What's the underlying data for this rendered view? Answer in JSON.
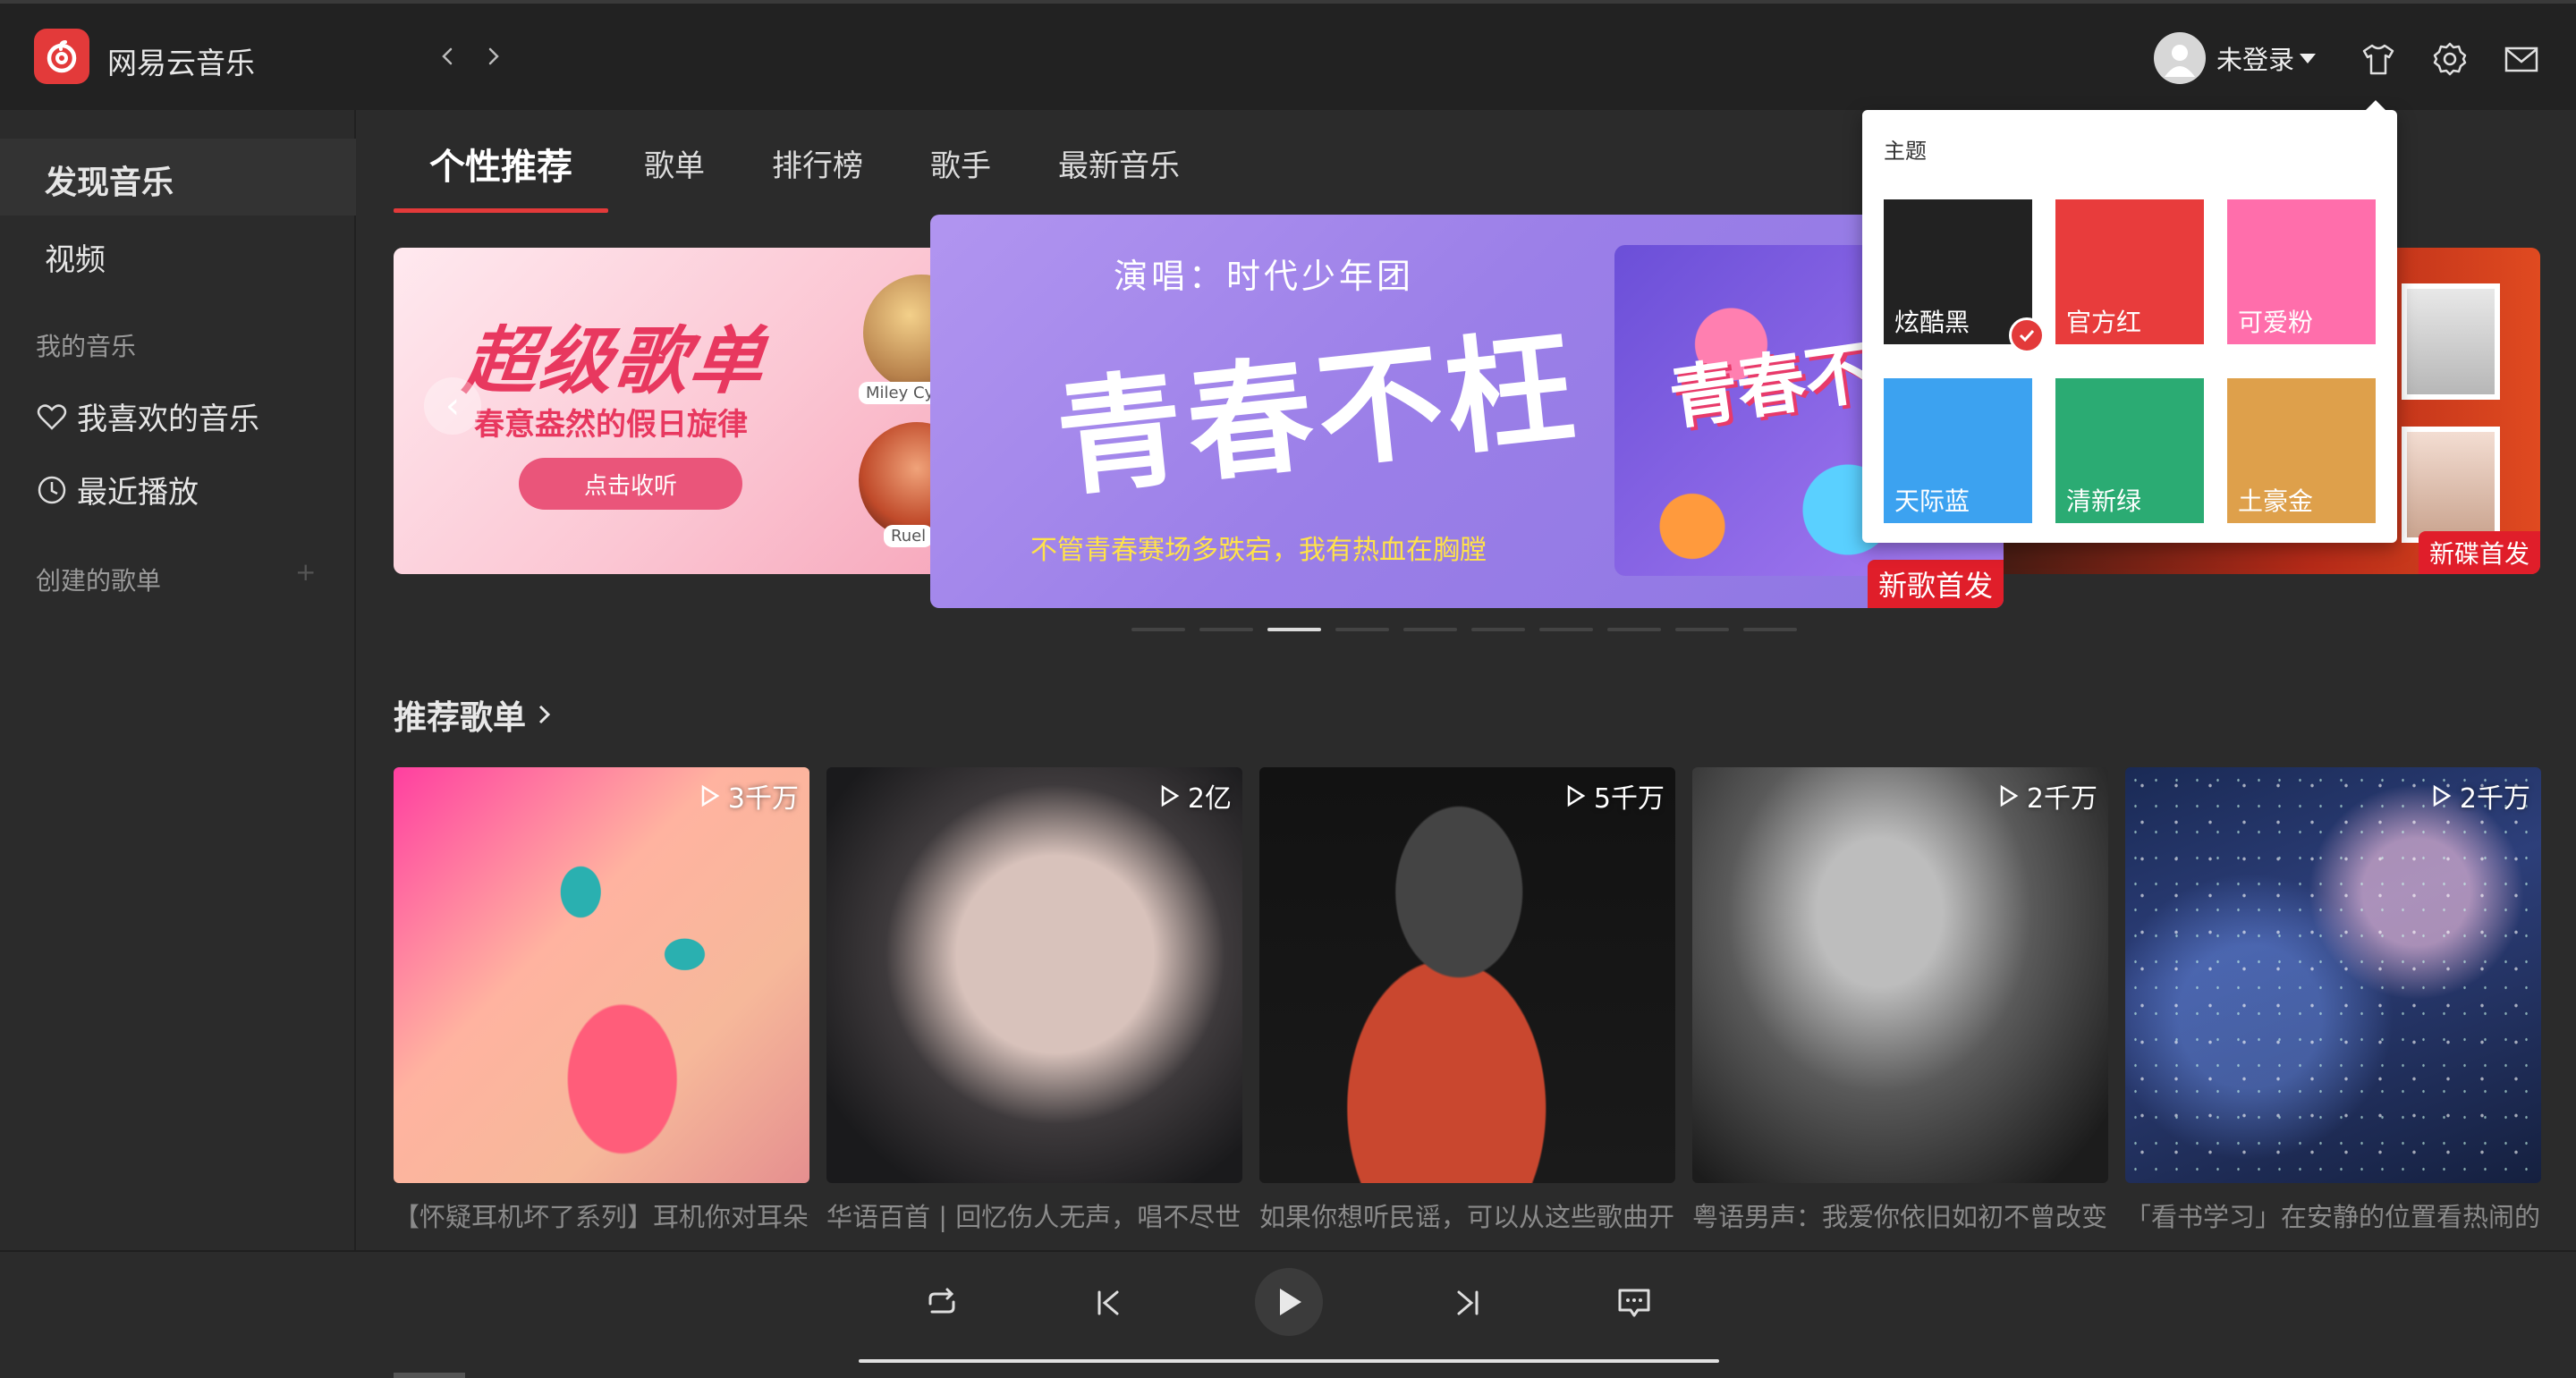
{
  "app": {
    "title": "网易云音乐"
  },
  "header": {
    "user_name": "未登录"
  },
  "sidebar": {
    "discover": "发现音乐",
    "video": "视频",
    "my_music_heading": "我的音乐",
    "liked_music": "我喜欢的音乐",
    "recent_play": "最近播放",
    "created_playlists_heading": "创建的歌单",
    "add_symbol": "+"
  },
  "tabs": [
    "个性推荐",
    "歌单",
    "排行榜",
    "歌手",
    "最新音乐"
  ],
  "banners": {
    "left": {
      "title": "超级歌单",
      "subtitle": "春意盎然的假日旋律",
      "button": "点击收听",
      "tag1": "Miley Cy",
      "tag2": "Ruel"
    },
    "main": {
      "singer": "演唱：时代少年团",
      "title": "青春不枉",
      "slogan": "不管青春赛场多跌宕，我有热血在胸膛",
      "art_title": "青春不枉",
      "badge": "新歌首发"
    },
    "right": {
      "badge": "新碟首发"
    },
    "dot_count": 10,
    "active_dot": 2
  },
  "section": {
    "recommended_title": "推荐歌单"
  },
  "playlists": [
    {
      "plays": "3千万",
      "title": "【怀疑耳机坏了系列】耳机你对耳朵做了什么"
    },
    {
      "plays": "2亿",
      "title": "华语百首 | 回忆伤人无声，唱不尽世间遗憾"
    },
    {
      "plays": "5千万",
      "title": "如果你想听民谣，可以从这些歌曲开始"
    },
    {
      "plays": "2千万",
      "title": "粤语男声：我爱你依旧如初不曾改变"
    },
    {
      "plays": "2千万",
      "title": "「看书学习」在安静的位置看热闹的世界"
    }
  ],
  "theme_popup": {
    "title": "主题",
    "swatches": [
      {
        "name": "炫酷黑",
        "color": "#222222",
        "selected": true
      },
      {
        "name": "官方红",
        "color": "#e83c3c",
        "selected": false
      },
      {
        "name": "可爱粉",
        "color": "#ff6eab",
        "selected": false
      },
      {
        "name": "天际蓝",
        "color": "#3ca2f0",
        "selected": false
      },
      {
        "name": "清新绿",
        "color": "#2bab73",
        "selected": false
      },
      {
        "name": "土豪金",
        "color": "#dea04b",
        "selected": false
      }
    ]
  },
  "colors": {
    "accent": "#e33a3a",
    "background": "#2b2b2b",
    "topbar": "#222222"
  }
}
